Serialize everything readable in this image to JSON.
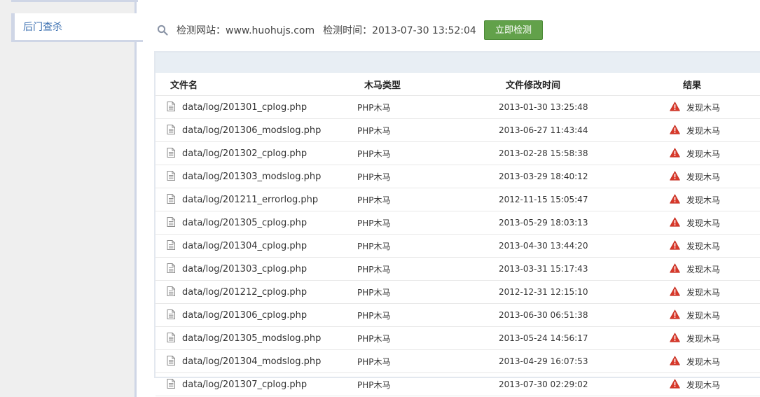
{
  "sidebar": {
    "items": [
      {
        "label": "后门查杀"
      }
    ]
  },
  "scan": {
    "site_label": "检测网站：www.huohujs.com",
    "time_label": "检测时间：2013-07-30 13:52:04",
    "button_label": "立即检测"
  },
  "table": {
    "headers": {
      "file": "文件名",
      "type": "木马类型",
      "time": "文件修改时间",
      "result": "结果"
    },
    "rows": [
      {
        "file": "data/log/201301_cplog.php",
        "type": "PHP木马",
        "time": "2013-01-30 13:25:48",
        "result": "发现木马"
      },
      {
        "file": "data/log/201306_modslog.php",
        "type": "PHP木马",
        "time": "2013-06-27 11:43:44",
        "result": "发现木马"
      },
      {
        "file": "data/log/201302_cplog.php",
        "type": "PHP木马",
        "time": "2013-02-28 15:58:38",
        "result": "发现木马"
      },
      {
        "file": "data/log/201303_modslog.php",
        "type": "PHP木马",
        "time": "2013-03-29 18:40:12",
        "result": "发现木马"
      },
      {
        "file": "data/log/201211_errorlog.php",
        "type": "PHP木马",
        "time": "2012-11-15 15:05:47",
        "result": "发现木马"
      },
      {
        "file": "data/log/201305_cplog.php",
        "type": "PHP木马",
        "time": "2013-05-29 18:03:13",
        "result": "发现木马"
      },
      {
        "file": "data/log/201304_cplog.php",
        "type": "PHP木马",
        "time": "2013-04-30 13:44:20",
        "result": "发现木马"
      },
      {
        "file": "data/log/201303_cplog.php",
        "type": "PHP木马",
        "time": "2013-03-31 15:17:43",
        "result": "发现木马"
      },
      {
        "file": "data/log/201212_cplog.php",
        "type": "PHP木马",
        "time": "2012-12-31 12:15:10",
        "result": "发现木马"
      },
      {
        "file": "data/log/201306_cplog.php",
        "type": "PHP木马",
        "time": "2013-06-30 06:51:38",
        "result": "发现木马"
      },
      {
        "file": "data/log/201305_modslog.php",
        "type": "PHP木马",
        "time": "2013-05-24 14:56:17",
        "result": "发现木马"
      },
      {
        "file": "data/log/201304_modslog.php",
        "type": "PHP木马",
        "time": "2013-04-29 16:07:53",
        "result": "发现木马"
      },
      {
        "file": "data/log/201307_cplog.php",
        "type": "PHP木马",
        "time": "2013-07-30 02:29:02",
        "result": "发现木马"
      }
    ]
  },
  "colors": {
    "accent_green": "#62a14a",
    "alert_red": "#d9392b",
    "link_blue": "#3a6fb0"
  },
  "icons": {
    "search": "search-icon",
    "file": "file-icon",
    "warning": "warning-icon"
  }
}
